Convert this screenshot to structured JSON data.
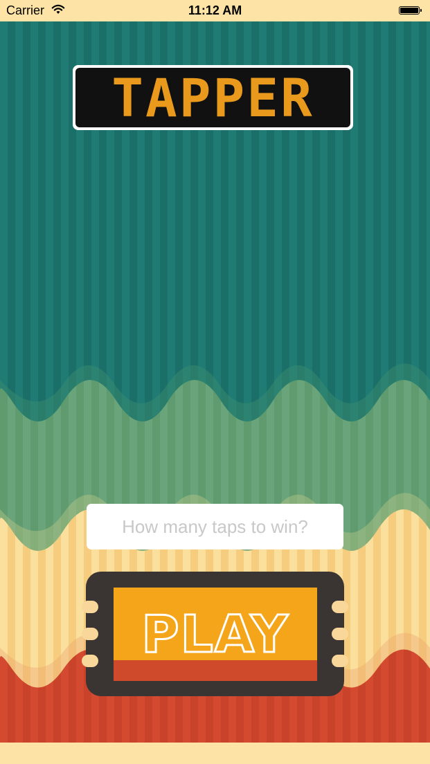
{
  "status_bar": {
    "carrier": "Carrier",
    "time": "11:12 AM",
    "wifi_icon": "wifi-icon",
    "battery_icon": "battery-icon"
  },
  "logo": {
    "text": "TAPPER",
    "color": "#e99a1c"
  },
  "taps_input": {
    "value": "",
    "placeholder": "How many taps to win?"
  },
  "play_button": {
    "label": "PLAY",
    "color": "#f5a519"
  },
  "colors": {
    "teal": "#1f7b73",
    "green": "#5f9b6f",
    "cream": "#f9d79a",
    "red": "#d44a30",
    "frame": "#3a3533"
  }
}
